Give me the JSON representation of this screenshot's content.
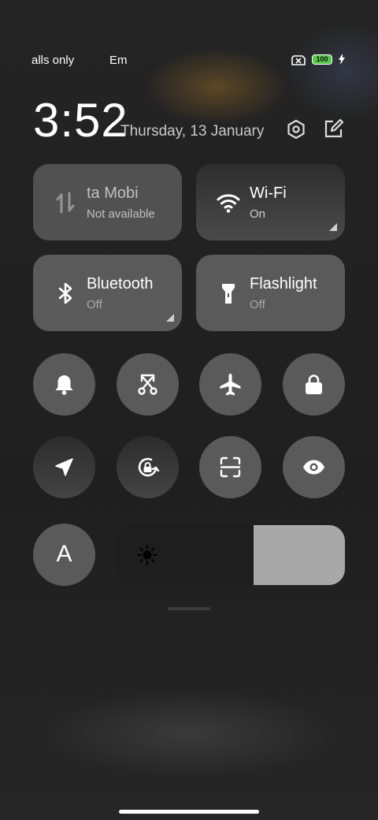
{
  "status_bar": {
    "left_text": "alls only",
    "left_text_2": "Em",
    "battery_level": "100",
    "battery_color": "#5ac84c",
    "icons": [
      "no-sim-icon",
      "battery-icon",
      "charging-bolt-icon"
    ]
  },
  "header": {
    "time": "3:52",
    "date": "Thursday, 13 January",
    "settings_icon": "settings-hexagon-icon",
    "edit_icon": "edit-icon"
  },
  "tiles": [
    {
      "name": "ta     Mobi",
      "status": "Not available",
      "icon": "mobile-data-icon",
      "state": "disabled"
    },
    {
      "name": "Wi-Fi",
      "status": "On",
      "icon": "wifi-icon",
      "state": "on"
    },
    {
      "name": "Bluetooth",
      "status": "Off",
      "icon": "bluetooth-icon",
      "state": "off"
    },
    {
      "name": "Flashlight",
      "status": "Off",
      "icon": "flashlight-icon",
      "state": "off"
    }
  ],
  "toggles": [
    {
      "icon": "bell-icon",
      "state": "off"
    },
    {
      "icon": "screenshot-cut-icon",
      "state": "off"
    },
    {
      "icon": "airplane-icon",
      "state": "off"
    },
    {
      "icon": "lock-icon",
      "state": "off"
    },
    {
      "icon": "location-icon",
      "state": "on"
    },
    {
      "icon": "rotation-lock-icon",
      "state": "on"
    },
    {
      "icon": "scanner-icon",
      "state": "off"
    },
    {
      "icon": "reading-mode-eye-icon",
      "state": "off"
    },
    {
      "icon": "auto-brightness-icon",
      "label": "A",
      "state": "off"
    }
  ],
  "brightness": {
    "icon": "sun-icon",
    "level": 0.4
  }
}
